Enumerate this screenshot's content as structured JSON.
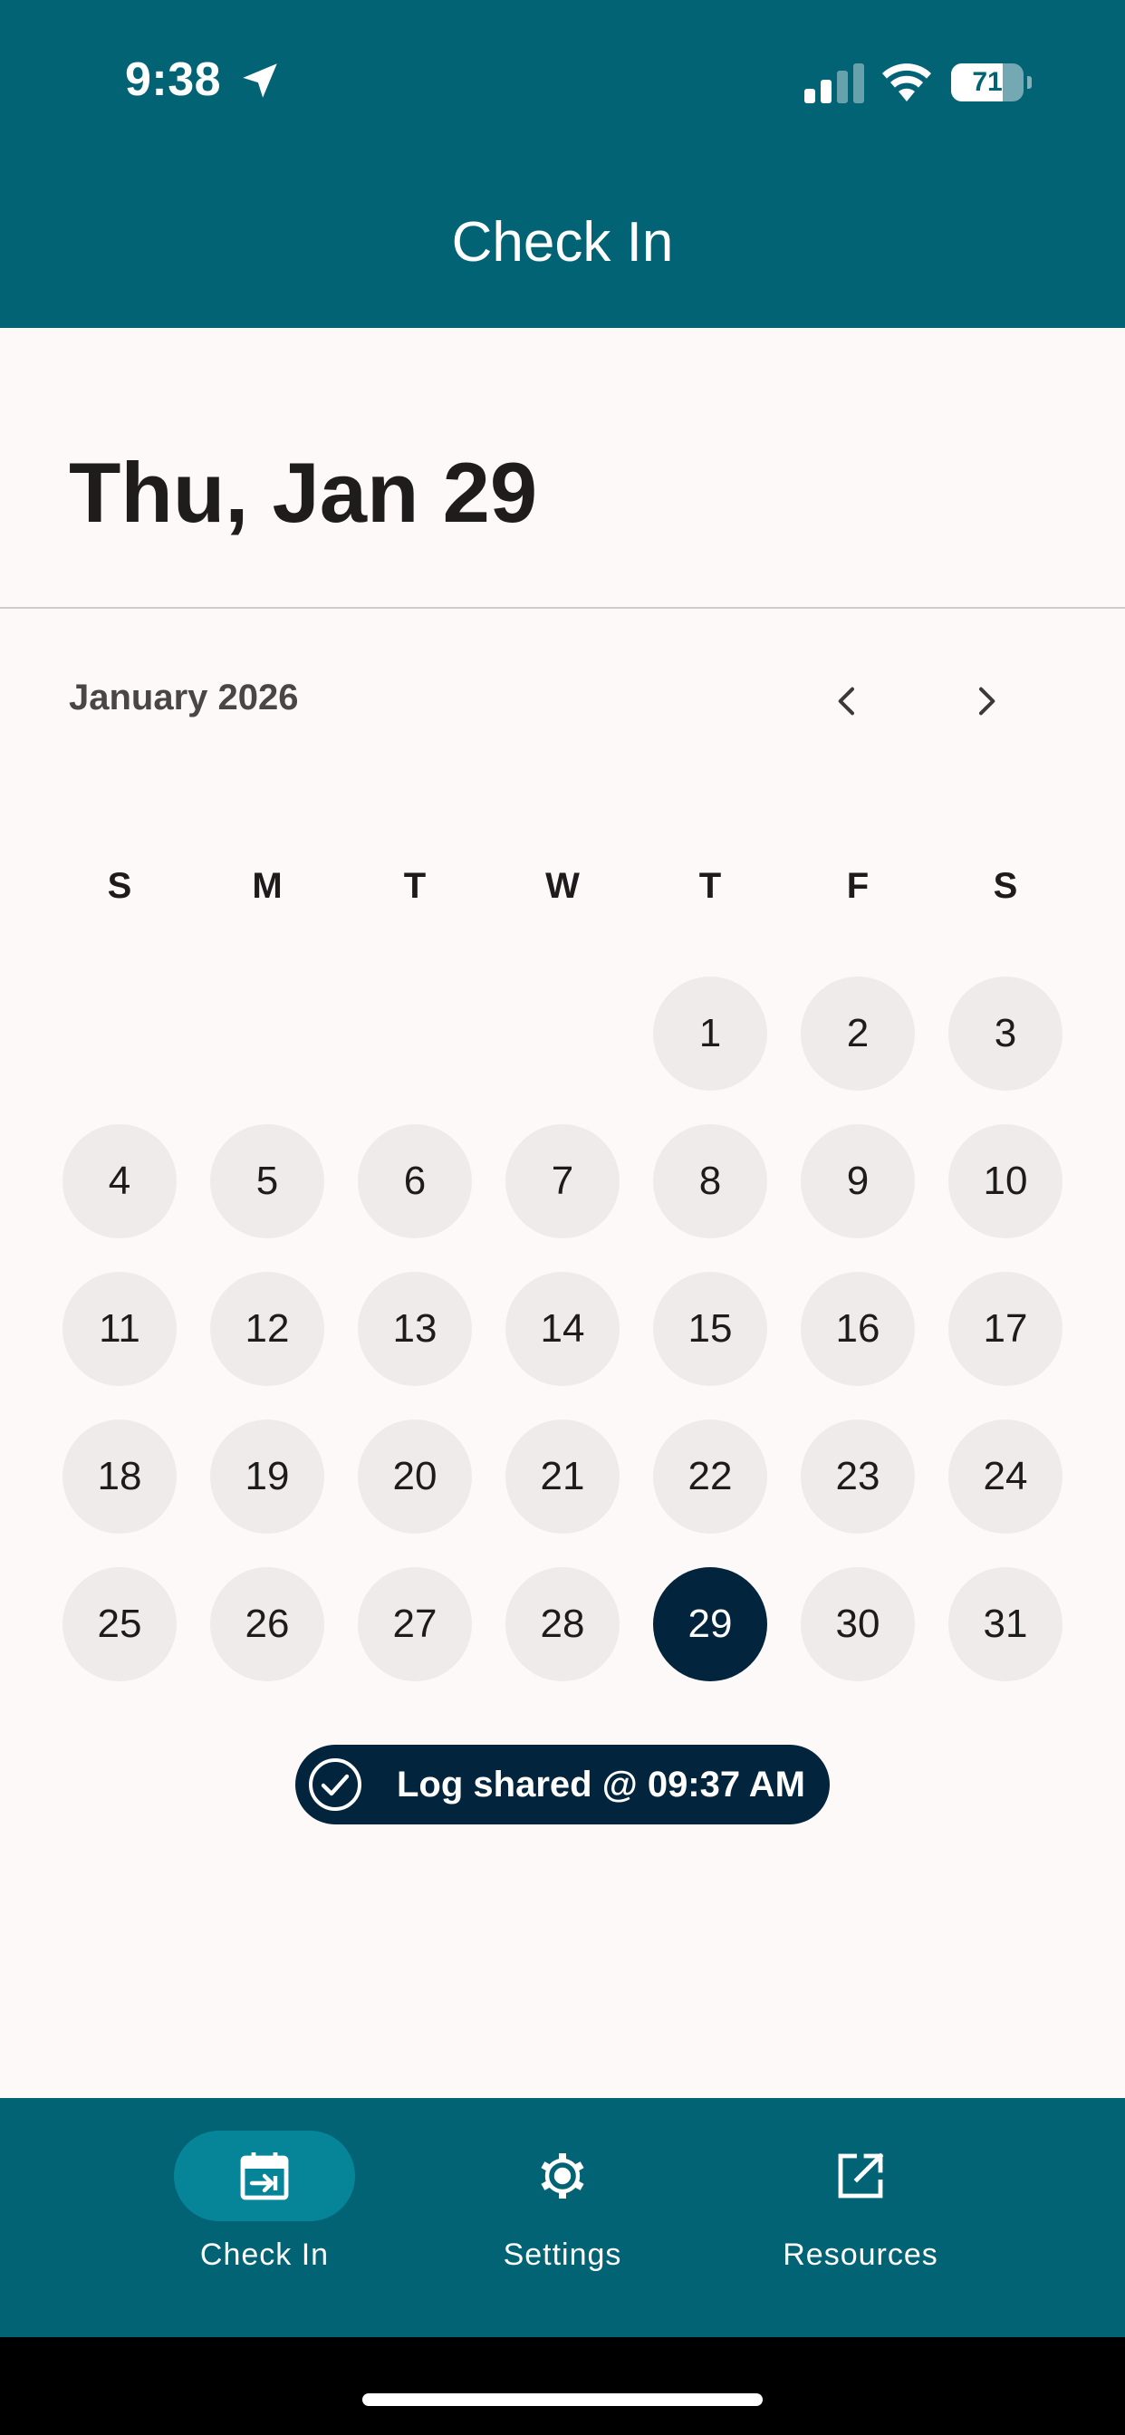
{
  "status_bar": {
    "time": "9:38",
    "battery_level": "71",
    "icons": [
      "location-arrow-icon",
      "cellular-signal-icon",
      "wifi-icon",
      "battery-icon"
    ]
  },
  "header": {
    "title": "Check In",
    "background_color": "#026375"
  },
  "selected_date_label": "Thu, Jan 29",
  "calendar": {
    "month_label": "January 2026",
    "prev_icon": "chevron-left-icon",
    "next_icon": "chevron-right-icon",
    "weekdays": [
      "S",
      "M",
      "T",
      "W",
      "T",
      "F",
      "S"
    ],
    "selected_day": "29",
    "selected_color": "#02243d",
    "weeks": [
      [
        "",
        "",
        "",
        "",
        "1",
        "2",
        "3"
      ],
      [
        "4",
        "5",
        "6",
        "7",
        "8",
        "9",
        "10"
      ],
      [
        "11",
        "12",
        "13",
        "14",
        "15",
        "16",
        "17"
      ],
      [
        "18",
        "19",
        "20",
        "21",
        "22",
        "23",
        "24"
      ],
      [
        "25",
        "26",
        "27",
        "28",
        "29",
        "30",
        "31"
      ]
    ]
  },
  "log_status": {
    "text": "Log shared @ 09:37 AM",
    "icon": "check-circle-icon"
  },
  "bottom_nav": {
    "items": [
      {
        "label": "Check In",
        "icon": "calendar-check-in-icon",
        "active": true
      },
      {
        "label": "Settings",
        "icon": "gear-icon",
        "active": false
      },
      {
        "label": "Resources",
        "icon": "external-link-icon",
        "active": false
      }
    ]
  }
}
